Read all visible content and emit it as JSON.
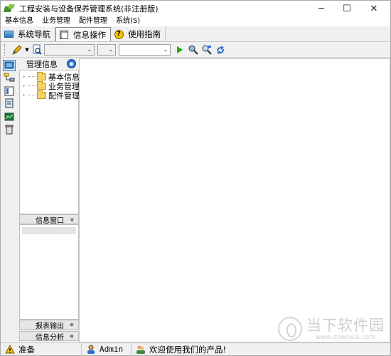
{
  "window": {
    "title": "工程安装与设备保养管理系统(非注册版)",
    "controls": {
      "minimize": "─",
      "maximize": "☐",
      "close": "✕"
    }
  },
  "menu": {
    "items": [
      "基本信息",
      "业务管理",
      "配件管理",
      "系统(S)"
    ]
  },
  "tabs": [
    {
      "label": "系统导航",
      "icon": "monitor-icon"
    },
    {
      "label": "信息操作",
      "icon": "form-icon",
      "active": true
    },
    {
      "label": "使用指南",
      "icon": "help-icon"
    }
  ],
  "toolbar": {
    "combo1_value": "",
    "combo2_value": "",
    "combo3_value": "",
    "dropdown_arrow": "⌄"
  },
  "side_panel": {
    "title": "管理信息",
    "pin_glyph": "◉",
    "tree": [
      {
        "label": "基本信息"
      },
      {
        "label": "业务管理"
      },
      {
        "label": "配件管理"
      }
    ],
    "tree_expander": "›",
    "info_window": {
      "label": "信息窗口",
      "chevron": "»"
    },
    "report_output": {
      "label": "报表输出",
      "chevron": "«"
    },
    "info_analysis": {
      "label": "信息分析",
      "chevron": "«"
    }
  },
  "statusbar": {
    "status": "准备",
    "user": "Admin",
    "message": "欢迎使用我们的产品!"
  },
  "watermark": {
    "cn": "当下软件园",
    "en": "www.downxia.com"
  },
  "colors": {
    "accent": "#2a6fd6",
    "folder": "#f4d36a",
    "run_green": "#1faa00"
  }
}
